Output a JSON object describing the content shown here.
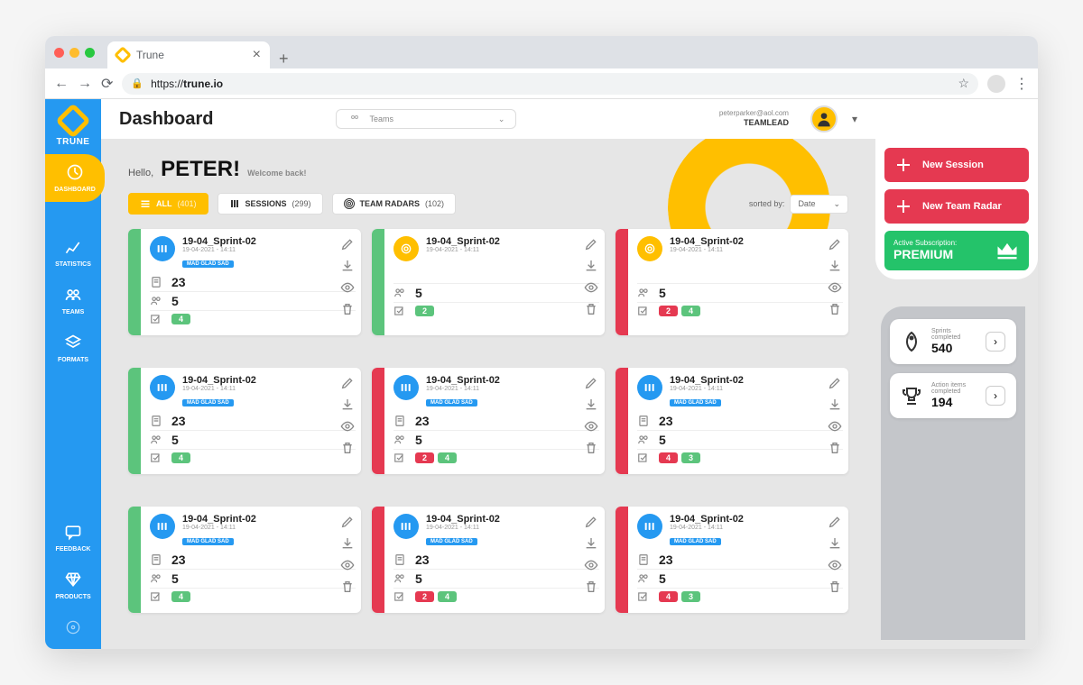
{
  "browser": {
    "tab_title": "Trune",
    "url_prefix": "https://",
    "url_host": "trune.io"
  },
  "header": {
    "page_title": "Dashboard",
    "team_selector_label": "Teams",
    "user_email": "peterparker@aol.com",
    "user_role": "TEAMLEAD"
  },
  "greeting": {
    "hello": "Hello,",
    "name": "PETER!",
    "welcome": "Welcome back!"
  },
  "filters": {
    "all_label": "ALL",
    "all_count": "(401)",
    "sessions_label": "SESSIONS",
    "sessions_count": "(299)",
    "radars_label": "TEAM RADARS",
    "radars_count": "(102)",
    "sort_label": "sorted by:",
    "sort_value": "Date"
  },
  "cards": [
    {
      "stripe": "green",
      "icon": "blue",
      "title": "19-04_Sprint-02",
      "date": "19-04-2021 - 14:11",
      "tag": "MAD GLAD SAD",
      "docs": "23",
      "people": "5",
      "badges": [
        {
          "c": "green",
          "v": "4"
        }
      ]
    },
    {
      "stripe": "green",
      "icon": "gold",
      "title": "19-04_Sprint-02",
      "date": "19-04-2021 - 14:11",
      "tag": "",
      "docs": "",
      "people": "5",
      "badges": [
        {
          "c": "green",
          "v": "2"
        }
      ]
    },
    {
      "stripe": "red",
      "icon": "gold",
      "title": "19-04_Sprint-02",
      "date": "19-04-2021 - 14:11",
      "tag": "",
      "docs": "",
      "people": "5",
      "badges": [
        {
          "c": "red",
          "v": "2"
        },
        {
          "c": "green",
          "v": "4"
        }
      ]
    },
    {
      "stripe": "green",
      "icon": "blue",
      "title": "19-04_Sprint-02",
      "date": "19-04-2021 - 14:11",
      "tag": "MAD GLAD SAD",
      "docs": "23",
      "people": "5",
      "badges": [
        {
          "c": "green",
          "v": "4"
        }
      ]
    },
    {
      "stripe": "red",
      "icon": "blue",
      "title": "19-04_Sprint-02",
      "date": "19-04-2021 - 14:11",
      "tag": "MAD GLAD SAD",
      "docs": "23",
      "people": "5",
      "badges": [
        {
          "c": "red",
          "v": "2"
        },
        {
          "c": "green",
          "v": "4"
        }
      ]
    },
    {
      "stripe": "red",
      "icon": "blue",
      "title": "19-04_Sprint-02",
      "date": "19-04-2021 - 14:11",
      "tag": "MAD GLAD SAD",
      "docs": "23",
      "people": "5",
      "badges": [
        {
          "c": "red",
          "v": "4"
        },
        {
          "c": "green",
          "v": "3"
        }
      ]
    },
    {
      "stripe": "green",
      "icon": "blue",
      "title": "19-04_Sprint-02",
      "date": "19-04-2021 - 14:11",
      "tag": "MAD GLAD SAD",
      "docs": "23",
      "people": "5",
      "badges": [
        {
          "c": "green",
          "v": "4"
        }
      ]
    },
    {
      "stripe": "red",
      "icon": "blue",
      "title": "19-04_Sprint-02",
      "date": "19-04-2021 - 14:11",
      "tag": "MAD GLAD SAD",
      "docs": "23",
      "people": "5",
      "badges": [
        {
          "c": "red",
          "v": "2"
        },
        {
          "c": "green",
          "v": "4"
        }
      ]
    },
    {
      "stripe": "red",
      "icon": "blue",
      "title": "19-04_Sprint-02",
      "date": "19-04-2021 - 14:11",
      "tag": "MAD GLAD SAD",
      "docs": "23",
      "people": "5",
      "badges": [
        {
          "c": "red",
          "v": "4"
        },
        {
          "c": "green",
          "v": "3"
        }
      ]
    }
  ],
  "sidebar": {
    "brand": "TRUNE",
    "items": [
      {
        "label": "DASHBOARD",
        "active": true
      },
      {
        "label": "STATISTICS"
      },
      {
        "label": "TEAMS"
      },
      {
        "label": "FORMATS"
      },
      {
        "label": "FEEDBACK"
      },
      {
        "label": "PRODUCTS"
      }
    ]
  },
  "actions": {
    "new_session": "New Session",
    "new_radar": "New Team Radar",
    "sub_small": "Active Subscription:",
    "sub_big": "PREMIUM"
  },
  "stats": {
    "sprints_label": "Sprints completed",
    "sprints_value": "540",
    "actions_label": "Action items completed",
    "actions_value": "194"
  }
}
